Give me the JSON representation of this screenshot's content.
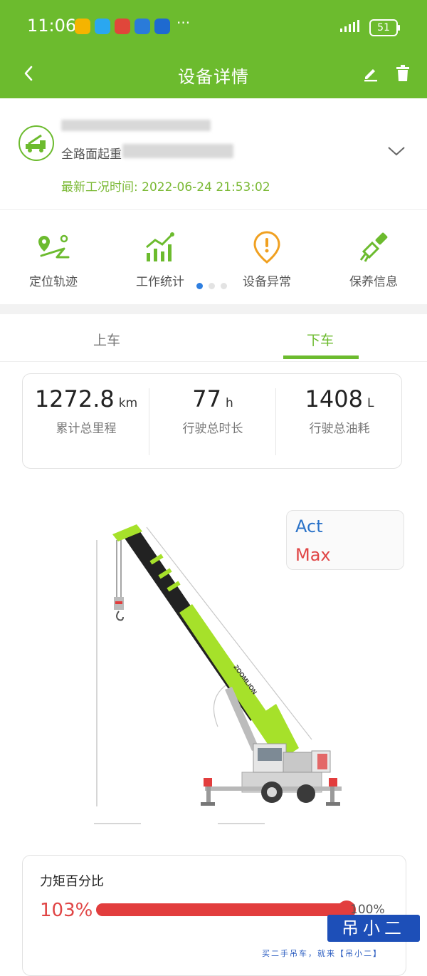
{
  "status_bar": {
    "time": "11:06",
    "more": "···",
    "battery": "51",
    "notification_icons": [
      "weibo-icon",
      "chat-icon",
      "news-icon",
      "browser-icon",
      "app-icon"
    ]
  },
  "nav": {
    "title": "设备详情"
  },
  "device": {
    "type_label": "全路面起重",
    "latest_condition_label": "最新工况时间:",
    "latest_condition_time": "2022-06-24 21:53:02"
  },
  "menu": {
    "items": [
      {
        "label": "定位轨迹",
        "icon": "location-track-icon"
      },
      {
        "label": "工作统计",
        "icon": "bar-chart-icon"
      },
      {
        "label": "设备异常",
        "icon": "warning-pin-icon"
      },
      {
        "label": "保养信息",
        "icon": "brush-icon"
      }
    ]
  },
  "tabs": [
    {
      "label": "上车",
      "active": false
    },
    {
      "label": "下车",
      "active": true
    }
  ],
  "stats": [
    {
      "value": "1272.8",
      "unit": "km",
      "caption": "累计总里程"
    },
    {
      "value": "77",
      "unit": "h",
      "caption": "行驶总时长"
    },
    {
      "value": "1408",
      "unit": "L",
      "caption": "行驶总油耗"
    }
  ],
  "legend": {
    "act": "Act",
    "max": "Max",
    "act_color": "#2a72c8",
    "max_color": "#e04545"
  },
  "torque": {
    "title": "力矩百分比",
    "value_label": "103%",
    "max_label": "100%",
    "fill_fraction": 1.0
  },
  "crane_brand": "ZOOMLION",
  "watermark": {
    "badge": "吊小二",
    "slogan": "买二手吊车，就来【吊小二】"
  },
  "colors": {
    "brand_green": "#6cbb2e",
    "lime": "#a6e12a",
    "danger": "#e23d3d"
  }
}
